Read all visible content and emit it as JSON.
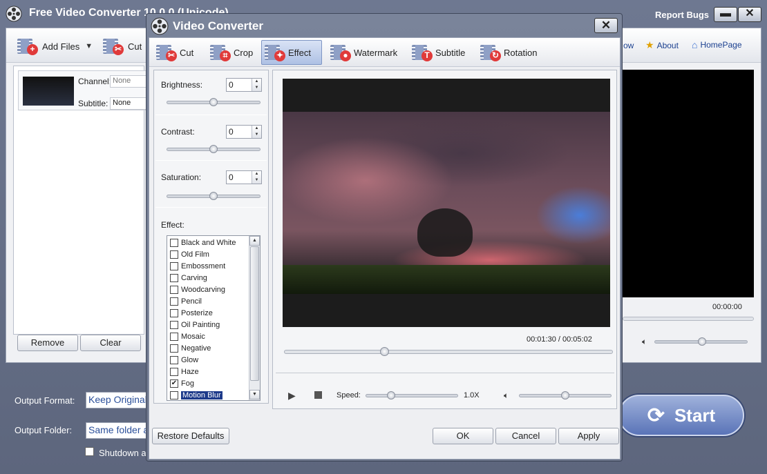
{
  "main": {
    "title": "Free Video Converter 10.0.0 (Unicode)",
    "report_bugs": "Report Bugs",
    "toolbar": {
      "add_files": "Add Files",
      "cut": "Cut",
      "show_partial": "ow",
      "about": "About",
      "homepage": "HomePage"
    },
    "file_item": {
      "channel_label": "Channel:",
      "channel_value": "None",
      "subtitle_label": "Subtitle:",
      "subtitle_value": "None"
    },
    "remove": "Remove",
    "clear": "Clear",
    "preview_time": "00:00:00",
    "output_format_label": "Output Format:",
    "output_format_value": "Keep Original",
    "output_folder_label": "Output Folder:",
    "output_folder_value": "Same folder a",
    "shutdown_label": "Shutdown a",
    "start": "Start"
  },
  "dialog": {
    "title": "Video Converter",
    "tabs": [
      {
        "label": "Cut"
      },
      {
        "label": "Crop"
      },
      {
        "label": "Effect"
      },
      {
        "label": "Watermark"
      },
      {
        "label": "Subtitle"
      },
      {
        "label": "Rotation"
      }
    ],
    "active_tab": "Effect",
    "brightness": {
      "label": "Brightness:",
      "value": "0",
      "level": 0.5
    },
    "contrast": {
      "label": "Contrast:",
      "value": "0",
      "level": 0.5
    },
    "saturation": {
      "label": "Saturation:",
      "value": "0",
      "level": 0.5
    },
    "effect_label": "Effect:",
    "effects": [
      {
        "label": "Black and White",
        "checked": false
      },
      {
        "label": "Old Film",
        "checked": false
      },
      {
        "label": "Embossment",
        "checked": false
      },
      {
        "label": "Carving",
        "checked": false
      },
      {
        "label": "Woodcarving",
        "checked": false
      },
      {
        "label": "Pencil",
        "checked": false
      },
      {
        "label": "Posterize",
        "checked": false
      },
      {
        "label": "Oil Painting",
        "checked": false
      },
      {
        "label": "Mosaic",
        "checked": false
      },
      {
        "label": "Negative",
        "checked": false
      },
      {
        "label": "Glow",
        "checked": false
      },
      {
        "label": "Haze",
        "checked": false
      },
      {
        "label": "Fog",
        "checked": true
      },
      {
        "label": "Motion Blur",
        "checked": false,
        "selected": true
      }
    ],
    "video": {
      "current_time": "00:01:30",
      "total_time": "00:05:02",
      "time_display": "00:01:30  /  00:05:02",
      "progress": 0.3,
      "speed_label": "Speed:",
      "speed_value": "1.0X",
      "speed_level": 0.25,
      "volume_level": 0.5
    },
    "buttons": {
      "restore_defaults": "Restore Defaults",
      "ok": "OK",
      "cancel": "Cancel",
      "apply": "Apply"
    }
  }
}
